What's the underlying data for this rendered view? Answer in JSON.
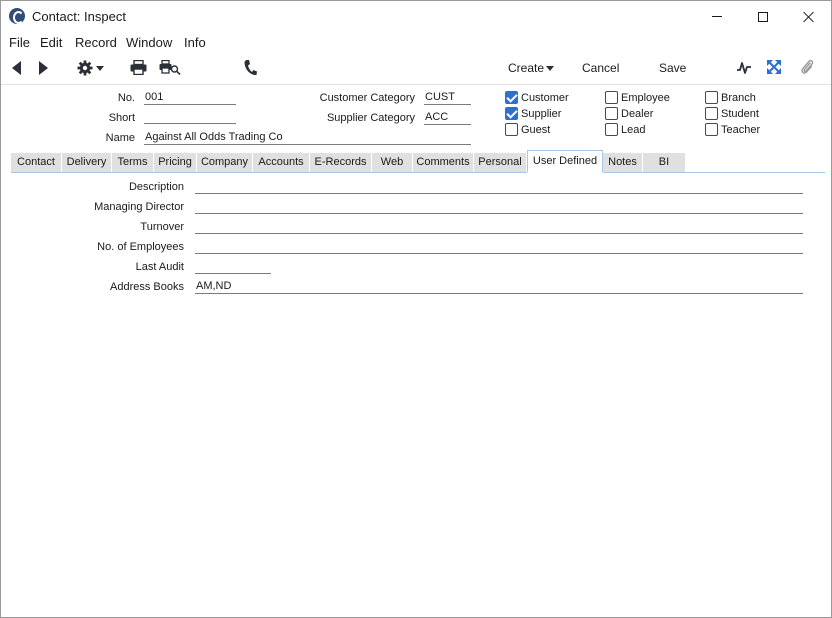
{
  "window": {
    "title": "Contact: Inspect"
  },
  "menu": [
    "File",
    "Edit",
    "Record",
    "Window",
    "Info"
  ],
  "toolbar": {
    "create_label": "Create",
    "cancel_label": "Cancel",
    "save_label": "Save"
  },
  "header": {
    "no_label": "No.",
    "no_value": "001",
    "short_label": "Short",
    "short_value": "",
    "name_label": "Name",
    "name_value": "Against All Odds Trading Co",
    "customer_category_label": "Customer Category",
    "customer_category_value": "CUST",
    "supplier_category_label": "Supplier Category",
    "supplier_category_value": "ACC"
  },
  "checkboxes": [
    {
      "label": "Customer",
      "checked": true
    },
    {
      "label": "Supplier",
      "checked": true
    },
    {
      "label": "Guest",
      "checked": false
    },
    {
      "label": "Employee",
      "checked": false
    },
    {
      "label": "Dealer",
      "checked": false
    },
    {
      "label": "Lead",
      "checked": false
    },
    {
      "label": "Branch",
      "checked": false
    },
    {
      "label": "Student",
      "checked": false
    },
    {
      "label": "Teacher",
      "checked": false
    }
  ],
  "tabs": [
    "Contact",
    "Delivery",
    "Terms",
    "Pricing",
    "Company",
    "Accounts",
    "E-Records",
    "Web",
    "Comments",
    "Personal",
    "User Defined",
    "Notes",
    "BI"
  ],
  "active_tab": "User Defined",
  "fields": [
    {
      "label": "Description",
      "value": ""
    },
    {
      "label": "Managing Director",
      "value": ""
    },
    {
      "label": "Turnover",
      "value": ""
    },
    {
      "label": "No. of Employees",
      "value": ""
    },
    {
      "label": "Last Audit",
      "value": ""
    },
    {
      "label": "Address Books",
      "value": "AM,ND"
    }
  ],
  "colors": {
    "accent": "#2f6fd0",
    "tab_inactive": "#e0e0e0",
    "tab_border": "#a7c5e6",
    "icon": "#2b2f38"
  }
}
